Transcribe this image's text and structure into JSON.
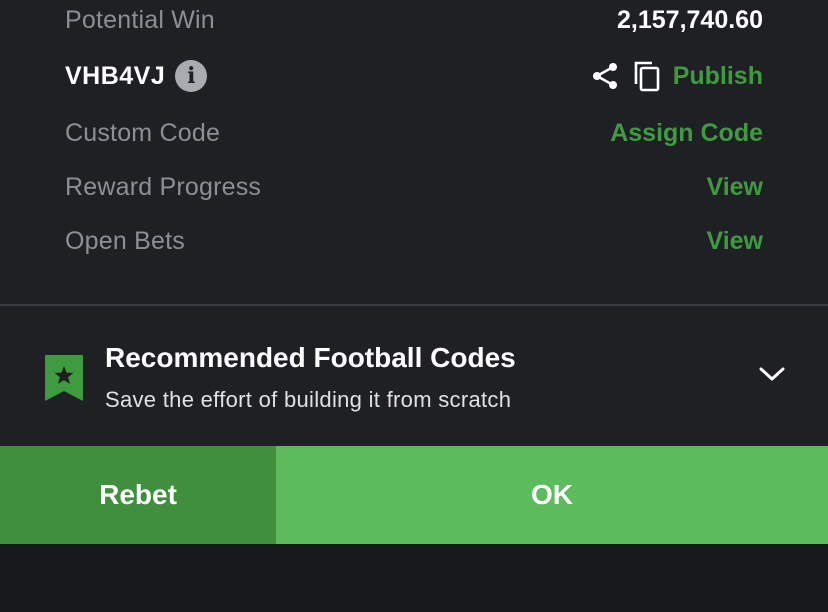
{
  "summary": {
    "potential_win": {
      "label": "Potential Win",
      "value": "2,157,740.60"
    },
    "booking_code": {
      "code": "VHB4VJ",
      "info_icon": "info-icon",
      "share_icon": "share-icon",
      "copy_icon": "copy-icon",
      "publish_label": "Publish"
    },
    "custom_code": {
      "label": "Custom Code",
      "action": "Assign Code"
    },
    "reward_progress": {
      "label": "Reward Progress",
      "action": "View"
    },
    "open_bets": {
      "label": "Open Bets",
      "action": "View"
    }
  },
  "recommendation": {
    "icon": "bookmark-star-icon",
    "title": "Recommended Football Codes",
    "subtitle": "Save the effort of building it from scratch",
    "toggle_icon": "chevron-down-icon"
  },
  "buttons": {
    "rebet": "Rebet",
    "ok": "OK"
  },
  "colors": {
    "accent_green": "#3f9b3f",
    "rebet_bg": "#3f8f3f",
    "ok_bg": "#5cbb5c",
    "panel_bg": "#1f2024"
  }
}
